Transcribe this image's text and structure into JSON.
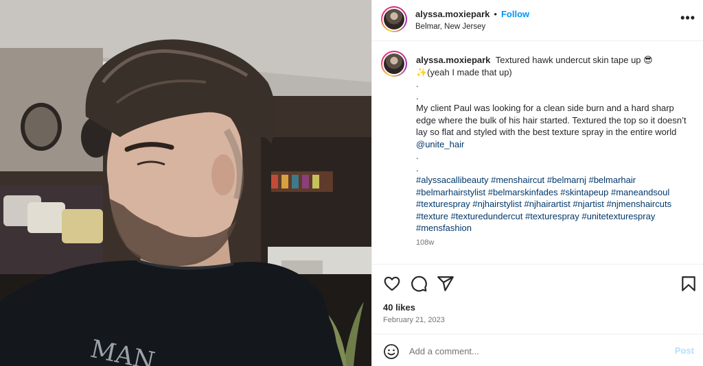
{
  "post": {
    "username": "alyssa.moxiepark",
    "dot": "•",
    "follow_label": "Follow",
    "location": "Belmar, New Jersey",
    "more_label": "•••"
  },
  "caption": {
    "username": "alyssa.moxiepark",
    "line1": "Textured hawk undercut skin tape up 😎",
    "line2": "✨(yeah I made that up)",
    "dot1": ".",
    "dot2": ".",
    "body": "My client Paul was looking for a clean side burn and a hard sharp edge where the bulk of his hair started. Textured the top so it doesn’t lay so flat and styled with the best texture spray in the entire world",
    "mention": "@unite_hair",
    "dot3": ".",
    "dot4": ".",
    "hashtags": "#alyssacallibeauty #menshaircut #belmarnj #belmarhair #belmarhairstylist #belmarskinfades #skintapeup #maneandsoul #texturespray #njhairstylist #njhairartist #njartist #njmenshaircuts #texture #texturedundercut #texturespray #unitetexturespray #mensfashion",
    "time": "108w"
  },
  "actions": {
    "icons": [
      "heart-icon",
      "comment-icon",
      "share-icon",
      "bookmark-icon"
    ],
    "likes": "40 likes",
    "date": "February 21, 2023"
  },
  "comment": {
    "placeholder": "Add a comment...",
    "post_label": "Post"
  },
  "colors": {
    "accent": "#0095f6",
    "hashtag": "#00376b",
    "muted": "#737373",
    "border": "#efefef"
  },
  "photo": {
    "shirt_text": "MAN"
  }
}
